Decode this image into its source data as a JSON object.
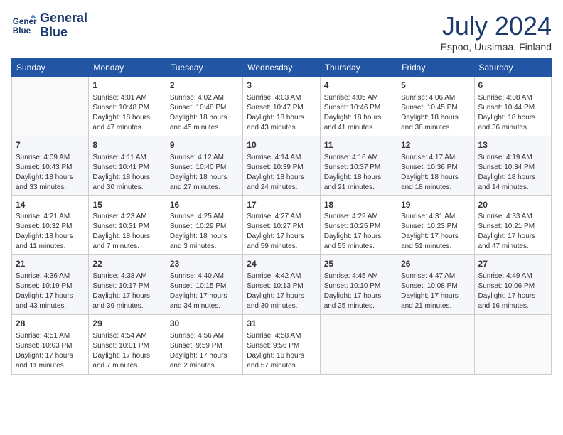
{
  "header": {
    "logo_line1": "General",
    "logo_line2": "Blue",
    "month_year": "July 2024",
    "location": "Espoo, Uusimaa, Finland"
  },
  "weekdays": [
    "Sunday",
    "Monday",
    "Tuesday",
    "Wednesday",
    "Thursday",
    "Friday",
    "Saturday"
  ],
  "weeks": [
    [
      {
        "day": "",
        "info": ""
      },
      {
        "day": "1",
        "info": "Sunrise: 4:01 AM\nSunset: 10:48 PM\nDaylight: 18 hours\nand 47 minutes."
      },
      {
        "day": "2",
        "info": "Sunrise: 4:02 AM\nSunset: 10:48 PM\nDaylight: 18 hours\nand 45 minutes."
      },
      {
        "day": "3",
        "info": "Sunrise: 4:03 AM\nSunset: 10:47 PM\nDaylight: 18 hours\nand 43 minutes."
      },
      {
        "day": "4",
        "info": "Sunrise: 4:05 AM\nSunset: 10:46 PM\nDaylight: 18 hours\nand 41 minutes."
      },
      {
        "day": "5",
        "info": "Sunrise: 4:06 AM\nSunset: 10:45 PM\nDaylight: 18 hours\nand 38 minutes."
      },
      {
        "day": "6",
        "info": "Sunrise: 4:08 AM\nSunset: 10:44 PM\nDaylight: 18 hours\nand 36 minutes."
      }
    ],
    [
      {
        "day": "7",
        "info": "Sunrise: 4:09 AM\nSunset: 10:43 PM\nDaylight: 18 hours\nand 33 minutes."
      },
      {
        "day": "8",
        "info": "Sunrise: 4:11 AM\nSunset: 10:41 PM\nDaylight: 18 hours\nand 30 minutes."
      },
      {
        "day": "9",
        "info": "Sunrise: 4:12 AM\nSunset: 10:40 PM\nDaylight: 18 hours\nand 27 minutes."
      },
      {
        "day": "10",
        "info": "Sunrise: 4:14 AM\nSunset: 10:39 PM\nDaylight: 18 hours\nand 24 minutes."
      },
      {
        "day": "11",
        "info": "Sunrise: 4:16 AM\nSunset: 10:37 PM\nDaylight: 18 hours\nand 21 minutes."
      },
      {
        "day": "12",
        "info": "Sunrise: 4:17 AM\nSunset: 10:36 PM\nDaylight: 18 hours\nand 18 minutes."
      },
      {
        "day": "13",
        "info": "Sunrise: 4:19 AM\nSunset: 10:34 PM\nDaylight: 18 hours\nand 14 minutes."
      }
    ],
    [
      {
        "day": "14",
        "info": "Sunrise: 4:21 AM\nSunset: 10:32 PM\nDaylight: 18 hours\nand 11 minutes."
      },
      {
        "day": "15",
        "info": "Sunrise: 4:23 AM\nSunset: 10:31 PM\nDaylight: 18 hours\nand 7 minutes."
      },
      {
        "day": "16",
        "info": "Sunrise: 4:25 AM\nSunset: 10:29 PM\nDaylight: 18 hours\nand 3 minutes."
      },
      {
        "day": "17",
        "info": "Sunrise: 4:27 AM\nSunset: 10:27 PM\nDaylight: 17 hours\nand 59 minutes."
      },
      {
        "day": "18",
        "info": "Sunrise: 4:29 AM\nSunset: 10:25 PM\nDaylight: 17 hours\nand 55 minutes."
      },
      {
        "day": "19",
        "info": "Sunrise: 4:31 AM\nSunset: 10:23 PM\nDaylight: 17 hours\nand 51 minutes."
      },
      {
        "day": "20",
        "info": "Sunrise: 4:33 AM\nSunset: 10:21 PM\nDaylight: 17 hours\nand 47 minutes."
      }
    ],
    [
      {
        "day": "21",
        "info": "Sunrise: 4:36 AM\nSunset: 10:19 PM\nDaylight: 17 hours\nand 43 minutes."
      },
      {
        "day": "22",
        "info": "Sunrise: 4:38 AM\nSunset: 10:17 PM\nDaylight: 17 hours\nand 39 minutes."
      },
      {
        "day": "23",
        "info": "Sunrise: 4:40 AM\nSunset: 10:15 PM\nDaylight: 17 hours\nand 34 minutes."
      },
      {
        "day": "24",
        "info": "Sunrise: 4:42 AM\nSunset: 10:13 PM\nDaylight: 17 hours\nand 30 minutes."
      },
      {
        "day": "25",
        "info": "Sunrise: 4:45 AM\nSunset: 10:10 PM\nDaylight: 17 hours\nand 25 minutes."
      },
      {
        "day": "26",
        "info": "Sunrise: 4:47 AM\nSunset: 10:08 PM\nDaylight: 17 hours\nand 21 minutes."
      },
      {
        "day": "27",
        "info": "Sunrise: 4:49 AM\nSunset: 10:06 PM\nDaylight: 17 hours\nand 16 minutes."
      }
    ],
    [
      {
        "day": "28",
        "info": "Sunrise: 4:51 AM\nSunset: 10:03 PM\nDaylight: 17 hours\nand 11 minutes."
      },
      {
        "day": "29",
        "info": "Sunrise: 4:54 AM\nSunset: 10:01 PM\nDaylight: 17 hours\nand 7 minutes."
      },
      {
        "day": "30",
        "info": "Sunrise: 4:56 AM\nSunset: 9:59 PM\nDaylight: 17 hours\nand 2 minutes."
      },
      {
        "day": "31",
        "info": "Sunrise: 4:58 AM\nSunset: 9:56 PM\nDaylight: 16 hours\nand 57 minutes."
      },
      {
        "day": "",
        "info": ""
      },
      {
        "day": "",
        "info": ""
      },
      {
        "day": "",
        "info": ""
      }
    ]
  ]
}
